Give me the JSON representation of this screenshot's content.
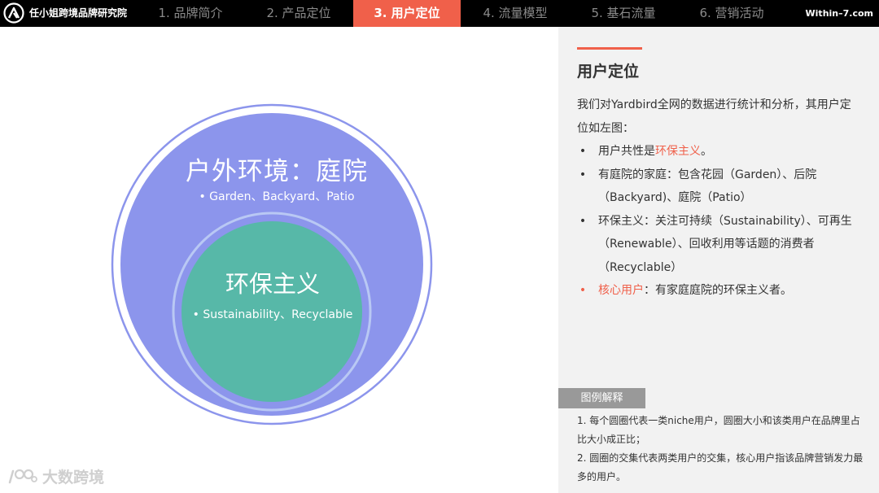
{
  "header": {
    "brand": "任小姐跨境品牌研究院",
    "site": "Within–7.com",
    "tabs": [
      {
        "label": "1. 品牌简介",
        "active": false
      },
      {
        "label": "2. 产品定位",
        "active": false
      },
      {
        "label": "3. 用户定位",
        "active": true
      },
      {
        "label": "4. 流量模型",
        "active": false
      },
      {
        "label": "5. 基石流量",
        "active": false
      },
      {
        "label": "6. 营销活动",
        "active": false
      }
    ]
  },
  "diagram": {
    "outer_title": "户外环境：庭院",
    "outer_sub": "Garden、Backyard、Patio",
    "inner_title": "环保主义",
    "inner_sub": "Sustainability、Recyclable"
  },
  "panel": {
    "title": "用户定位",
    "intro": "我们对Yardbird全网的数据进行统计和分析，其用户定位如左图：",
    "bullets": [
      {
        "prefix": "用户共性是",
        "highlight": "环保主义",
        "suffix": "。"
      },
      {
        "text": "有庭院的家庭：包含花园（Garden）、后院（Backyard)、庭院（Patio）"
      },
      {
        "text": "环保主义：关注可持续（Sustainability）、可再生（Renewable）、回收利用等话题的消费者（Recyclable）"
      },
      {
        "highlight": "核心用户",
        "suffix": "：有家庭庭院的环保主义者。"
      }
    ],
    "legend_title": "图例解释",
    "legend_items": [
      "1. 每个圆圈代表一类niche用户，圆圈大小和该类用户在品牌里占比大小成正比；",
      "2. 圆圈的交集代表两类用户的交集，核心用户指该品牌营销发力最多的用户。"
    ]
  },
  "watermark": "大数跨境",
  "colors": {
    "accent": "#f0604a",
    "outer_circle": "#8c95ec",
    "inner_circle": "#57b8a8",
    "panel_bg": "#f2f2f2",
    "legend_tag": "#999999"
  }
}
